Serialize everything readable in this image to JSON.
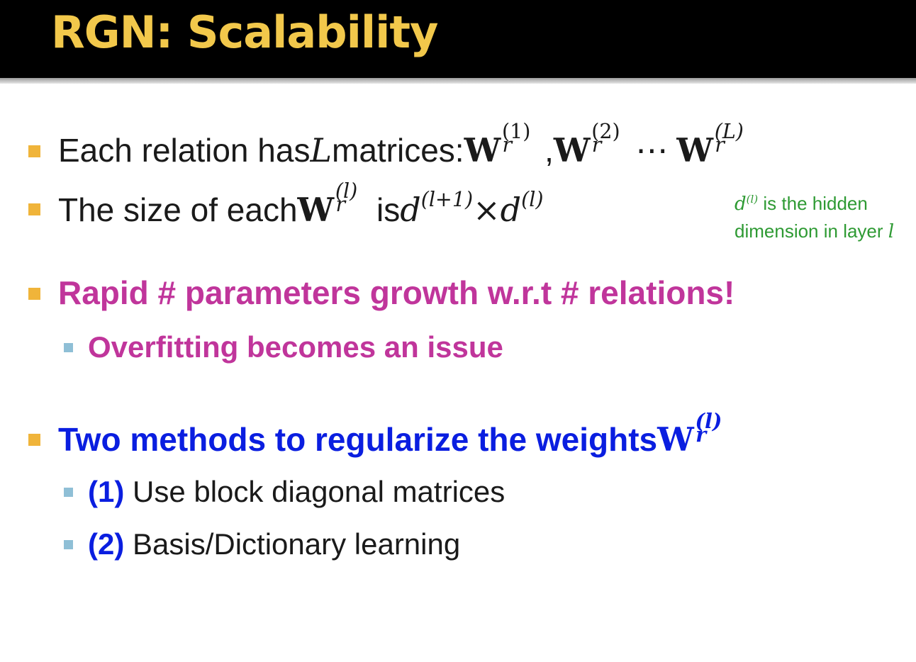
{
  "title": "RGN: Scalability",
  "bullets": {
    "b1": {
      "text_before": "Each relation has ",
      "var_L": "L",
      "text_after": " matrices: ",
      "mat_sym": "W",
      "sub": "r",
      "sup1": "(1)",
      "sup2": "(2)",
      "supL": "(L)",
      "comma": ",",
      "dots": "⋯"
    },
    "b2": {
      "text_before": "The size of each ",
      "mat_sym": "W",
      "sub": "r",
      "sup": "(l)",
      "text_is": " is ",
      "d": "d",
      "sup_a": "(l+1)",
      "times": "×",
      "sup_b": "(l)"
    },
    "b3": {
      "text": "Rapid # parameters growth w.r.t # relations!"
    },
    "b3_sub": {
      "text": "Overfitting becomes an issue"
    },
    "b4": {
      "text": "Two methods to regularize the weights ",
      "mat_sym": "W",
      "sub": "r",
      "sup": "(l)"
    },
    "b4_sub1": {
      "label": "(1)",
      "text": " Use block diagonal matrices"
    },
    "b4_sub2": {
      "label": "(2)",
      "text": " Basis/Dictionary learning"
    }
  },
  "side_note": {
    "d": "d",
    "sup": "(l)",
    "line1_rest": " is the hidden",
    "line2": "dimension in layer ",
    "l": "l"
  },
  "colors": {
    "title": "#f2c84b",
    "title_bg": "#000000",
    "bullet_l1": "#f0b43a",
    "bullet_l2": "#8fbfd6",
    "magenta": "#c0359b",
    "blue": "#0a1ee0",
    "note_green": "#2e9a33"
  }
}
